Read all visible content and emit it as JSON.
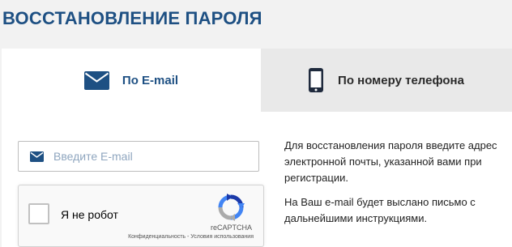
{
  "page": {
    "title": "ВОССТАНОВЛЕНИЕ ПАРОЛЯ"
  },
  "tabs": [
    {
      "label": "По E-mail",
      "icon": "envelope-icon",
      "active": true
    },
    {
      "label": "По номеру телефона",
      "icon": "smartphone-icon",
      "active": false
    }
  ],
  "form": {
    "email_placeholder": "Введите E-mail",
    "email_value": ""
  },
  "captcha": {
    "checkbox_label": "Я не робот",
    "brand": "reCAPTCHA",
    "terms": "Конфиденциальность - Условия использования",
    "checked": false
  },
  "help": {
    "paragraph1": "Для восстановления пароля введите адрес электронной почты, указанной вами при регистрации.",
    "paragraph2": "На Ваш e-mail будет выслано письмо с дальнейшими инструкциями."
  },
  "colors": {
    "accent": "#1e5083",
    "page_background": "#f2f2f2",
    "inactive_tab": "#e9e9e9"
  }
}
